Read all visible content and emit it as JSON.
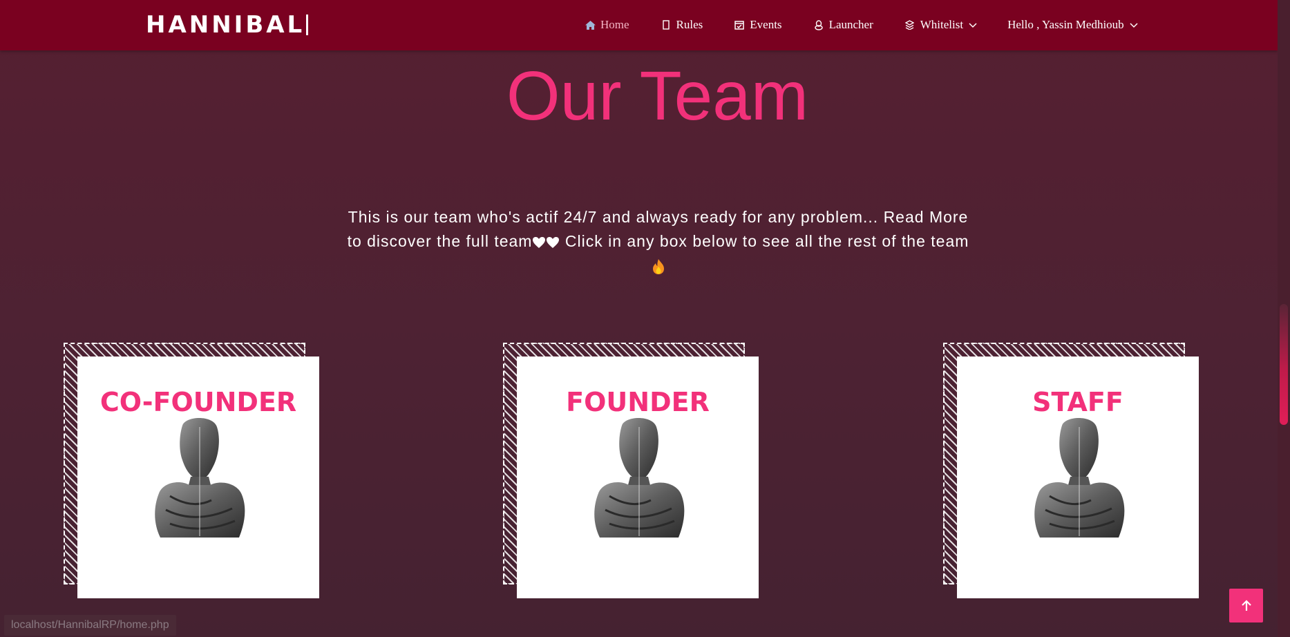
{
  "brand": {
    "name": "HANNIBAL"
  },
  "nav": {
    "items": [
      {
        "label": "Home",
        "icon": "home-icon",
        "active": true
      },
      {
        "label": "Rules",
        "icon": "book-icon"
      },
      {
        "label": "Events",
        "icon": "calendar-check-icon"
      },
      {
        "label": "Launcher",
        "icon": "linux-icon"
      },
      {
        "label": "Whitelist",
        "icon": "stack-icon",
        "dropdown": true
      },
      {
        "label": "Hello , Yassin Medhioub",
        "dropdown": true
      }
    ]
  },
  "hero": {
    "title": "Our Team",
    "intro_before": "This is our team who's actif 24/7 and always ready for any problem... Read More to discover the full team",
    "intro_after": " Click in any box below to see all the rest of the team",
    "icons": [
      "white-heart-icon",
      "white-heart-icon",
      "fire-icon"
    ]
  },
  "cards": [
    {
      "title": "CO-FOUNDER",
      "image": "hannibal-bust-icon"
    },
    {
      "title": "FOUNDER",
      "image": "hannibal-bust-icon"
    },
    {
      "title": "STAFF",
      "image": "hannibal-bust-icon"
    }
  ],
  "status_bar": {
    "url": "localhost/HannibalRP/home.php"
  },
  "colors": {
    "navbar": "#7a0120",
    "accent": "#f2317a",
    "background": "#561f31"
  }
}
